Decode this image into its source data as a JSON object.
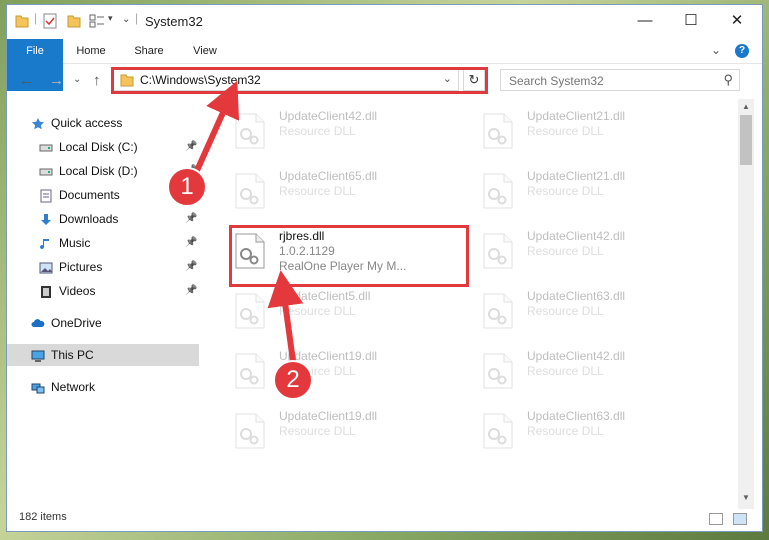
{
  "window": {
    "title": "System32",
    "controls": {
      "minimize": "—",
      "maximize": "☐",
      "close": "✕"
    }
  },
  "ribbon": {
    "tabs": [
      "File",
      "Home",
      "Share",
      "View"
    ],
    "expand": "⌄",
    "help": "?"
  },
  "nav": {
    "back": "←",
    "forward": "→",
    "recent": "⌄",
    "up": "↑",
    "address": "C:\\Windows\\System32",
    "address_dropdown": "⌄",
    "refresh": "↻",
    "search_placeholder": "Search System32",
    "search_icon": "⚲"
  },
  "sidebar": {
    "items": [
      {
        "label": "Quick access",
        "icon": "star-icon",
        "pinned": false
      },
      {
        "label": "Local Disk (C:)",
        "icon": "drive-icon",
        "pinned": true
      },
      {
        "label": "Local Disk (D:)",
        "icon": "drive-icon",
        "pinned": true
      },
      {
        "label": "Documents",
        "icon": "documents-icon",
        "pinned": true
      },
      {
        "label": "Downloads",
        "icon": "download-icon",
        "pinned": true
      },
      {
        "label": "Music",
        "icon": "music-icon",
        "pinned": true
      },
      {
        "label": "Pictures",
        "icon": "pictures-icon",
        "pinned": true
      },
      {
        "label": "Videos",
        "icon": "videos-icon",
        "pinned": true
      },
      {
        "label": "OneDrive",
        "icon": "cloud-icon",
        "pinned": false
      },
      {
        "label": "This PC",
        "icon": "computer-icon",
        "pinned": false,
        "selected": true
      },
      {
        "label": "Network",
        "icon": "network-icon",
        "pinned": false
      }
    ],
    "pin_glyph": "📌"
  },
  "files": [
    {
      "name": "UpdateClient42.dll",
      "line2": "Resource DLL",
      "line3": "",
      "faded": true
    },
    {
      "name": "UpdateClient21.dll",
      "line2": "Resource DLL",
      "line3": "",
      "faded": true
    },
    {
      "name": "UpdateClient65.dll",
      "line2": "Resource DLL",
      "line3": "",
      "faded": true
    },
    {
      "name": "UpdateClient21.dll",
      "line2": "Resource DLL",
      "line3": "",
      "faded": true
    },
    {
      "name": "rjbres.dll",
      "line2": "1.0.2.1129",
      "line3": "RealOne Player My M...",
      "faded": false
    },
    {
      "name": "UpdateClient42.dll",
      "line2": "Resource DLL",
      "line3": "",
      "faded": true
    },
    {
      "name": "UpdateClient5.dll",
      "line2": "Resource DLL",
      "line3": "",
      "faded": true
    },
    {
      "name": "UpdateClient63.dll",
      "line2": "Resource DLL",
      "line3": "",
      "faded": true
    },
    {
      "name": "UpdateClient19.dll",
      "line2": "Resource DLL",
      "line3": "",
      "faded": true
    },
    {
      "name": "UpdateClient42.dll",
      "line2": "Resource DLL",
      "line3": "",
      "faded": true
    },
    {
      "name": "UpdateClient19.dll",
      "line2": "Resource DLL",
      "line3": "",
      "faded": true
    },
    {
      "name": "UpdateClient63.dll",
      "line2": "Resource DLL",
      "line3": "",
      "faded": true
    }
  ],
  "status": {
    "item_count": "182 items"
  },
  "callouts": [
    "1",
    "2"
  ],
  "colors": {
    "accent": "#1979ca",
    "highlight": "#e0393e",
    "selected": "#d9d9d9"
  }
}
